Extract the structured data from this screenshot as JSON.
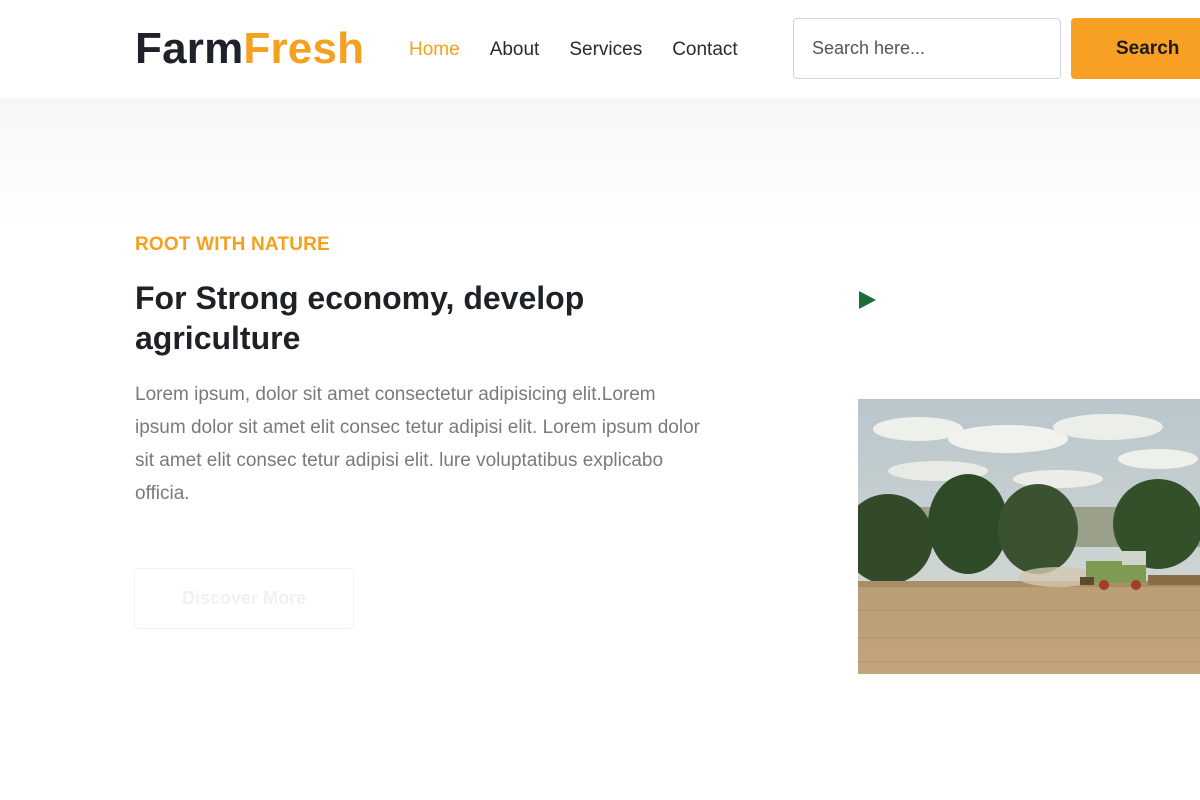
{
  "header": {
    "logo": {
      "part1": "Farm",
      "part2": "Fresh"
    },
    "nav": [
      {
        "label": "Home",
        "active": true
      },
      {
        "label": "About",
        "active": false
      },
      {
        "label": "Services",
        "active": false
      },
      {
        "label": "Contact",
        "active": false
      }
    ],
    "search": {
      "placeholder": "Search here...",
      "value": "",
      "button_label": "Search"
    }
  },
  "hero": {
    "eyebrow": "ROOT WITH NATURE",
    "headline": "For Strong economy, develop agriculture",
    "body": "Lorem ipsum, dolor sit amet consectetur adipisicing elit.Lorem ipsum dolor sit amet elit consec tetur adipisi elit. Lorem ipsum dolor sit amet elit consec tetur adipisi elit. lure voluptatibus explicabo officia.",
    "cta_label": "Discover More",
    "play_icon": "play-icon",
    "video_thumbnail": "harvest-field-image"
  },
  "colors": {
    "accent": "#f5a020",
    "play": "#1e6b3a",
    "text_dark": "#1e2125",
    "text_muted": "#7a7a7a"
  }
}
